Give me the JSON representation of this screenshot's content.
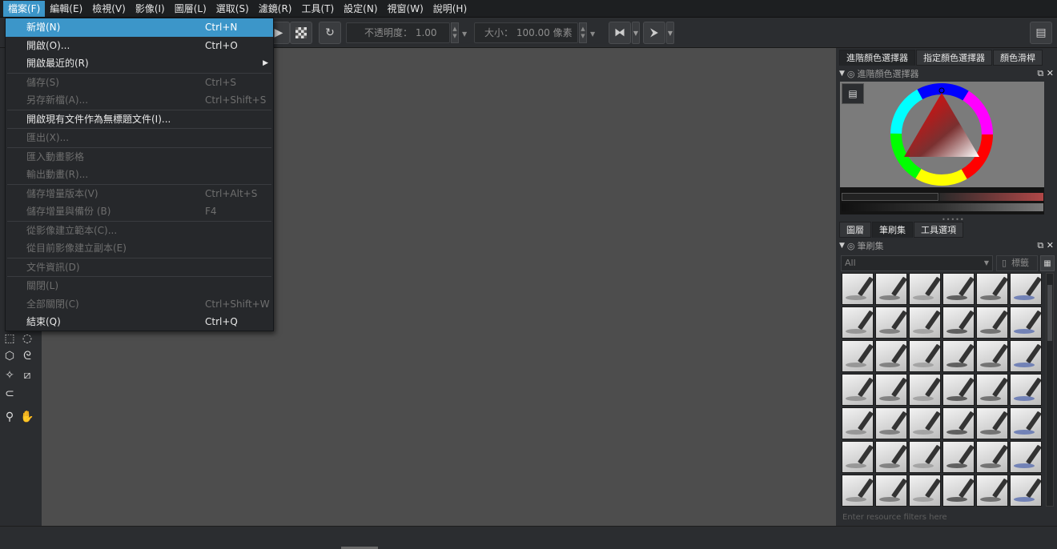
{
  "menubar": {
    "items": [
      "檔案(F)",
      "編輯(E)",
      "檢視(V)",
      "影像(I)",
      "圖層(L)",
      "選取(S)",
      "濾鏡(R)",
      "工具(T)",
      "設定(N)",
      "視窗(W)",
      "說明(H)"
    ],
    "active_index": 0
  },
  "toolbar": {
    "opacity_label": "不透明度： 1.00",
    "size_label": "大小： 100.00 像素"
  },
  "file_menu": {
    "items": [
      {
        "label": "新增(N)",
        "shortcut": "Ctrl+N",
        "state": "highlight"
      },
      {
        "label": "開啟(O)...",
        "shortcut": "Ctrl+O",
        "state": "enabled"
      },
      {
        "label": "開啟最近的(R)",
        "shortcut": "",
        "state": "enabled",
        "submenu": "▶"
      },
      {
        "label": "儲存(S)",
        "shortcut": "Ctrl+S",
        "state": "disabled"
      },
      {
        "label": "另存新檔(A)...",
        "shortcut": "Ctrl+Shift+S",
        "state": "disabled"
      },
      {
        "label": "開啟現有文件作為無標題文件(I)...",
        "shortcut": "",
        "state": "enabled"
      },
      {
        "label": "匯出(X)...",
        "shortcut": "",
        "state": "disabled"
      },
      {
        "label": "匯入動畫影格",
        "shortcut": "",
        "state": "disabled"
      },
      {
        "label": "輸出動畫(R)...",
        "shortcut": "",
        "state": "disabled"
      },
      {
        "label": "儲存增量版本(V)",
        "shortcut": "Ctrl+Alt+S",
        "state": "disabled"
      },
      {
        "label": "儲存增量與備份 (B)",
        "shortcut": "F4",
        "state": "disabled"
      },
      {
        "label": "從影像建立範本(C)...",
        "shortcut": "",
        "state": "disabled"
      },
      {
        "label": "從目前影像建立副本(E)",
        "shortcut": "",
        "state": "disabled"
      },
      {
        "label": "文件資訊(D)",
        "shortcut": "",
        "state": "disabled"
      },
      {
        "label": "關閉(L)",
        "shortcut": "",
        "state": "disabled"
      },
      {
        "label": "全部關閉(C)",
        "shortcut": "Ctrl+Shift+W",
        "state": "disabled"
      },
      {
        "label": "結束(Q)",
        "shortcut": "Ctrl+Q",
        "state": "enabled"
      }
    ],
    "separators_after": [
      2,
      4,
      5,
      6,
      8,
      10,
      12,
      13
    ]
  },
  "dock": {
    "color_tabs": [
      "進階顏色選擇器",
      "指定顏色選擇器",
      "顏色滑桿"
    ],
    "color_docker_title": "進階顏色選擇器",
    "layer_tabs": [
      "圖層",
      "筆刷集",
      "工具選項"
    ],
    "brush_docker_title": "筆刷集",
    "filter_placeholder": "All",
    "tag_label": "標籤",
    "filter_hint": "Enter resource filters here"
  },
  "colors": {
    "accent": "#3c96c9",
    "canvas": "#4d4d4d",
    "panel": "#2b2d30"
  }
}
